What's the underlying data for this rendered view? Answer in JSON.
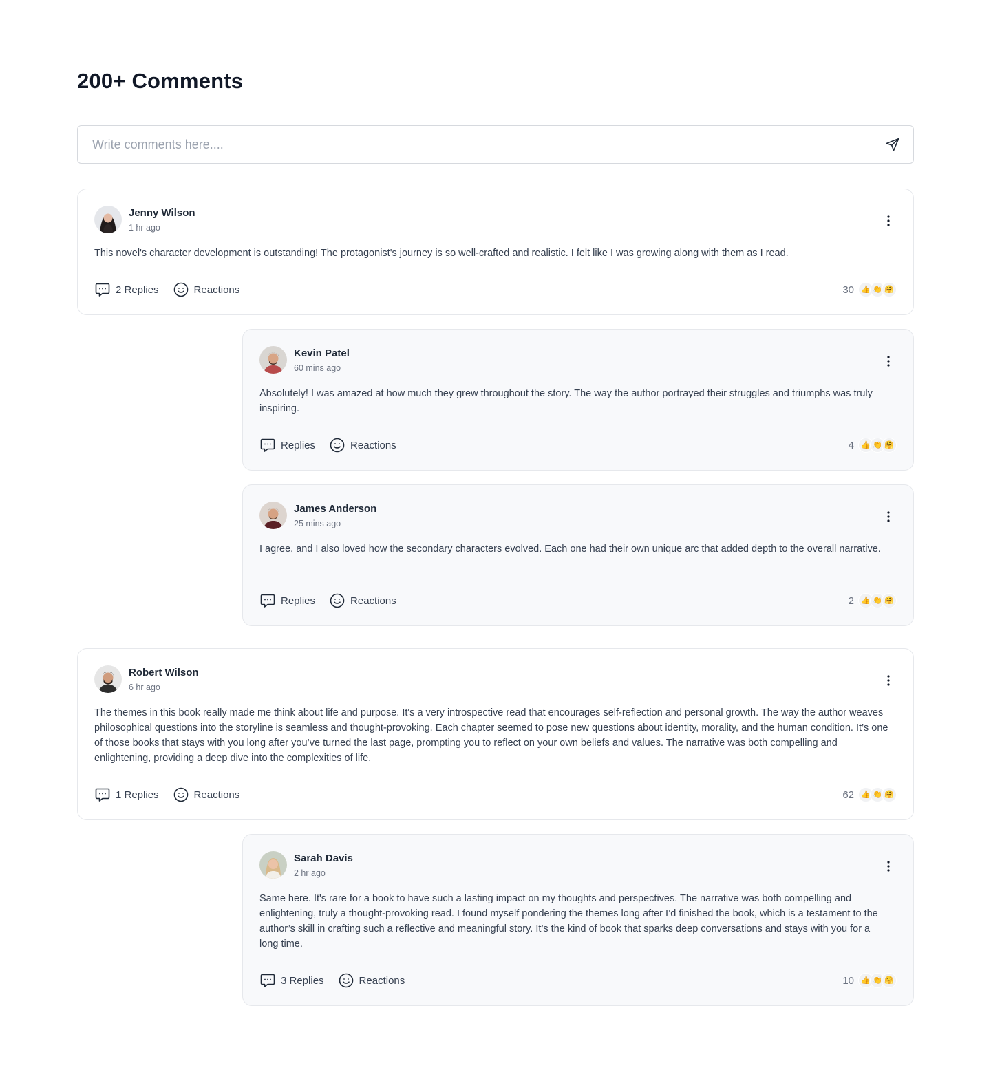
{
  "page": {
    "title": "200+ Comments"
  },
  "composer": {
    "placeholder": "Write comments here...."
  },
  "colors": {
    "card_border": "#e6e8ec",
    "reply_bg": "#f8f9fb",
    "text": "#374151"
  },
  "comments": [
    {
      "name": "Jenny Wilson",
      "time": "1 hr ago",
      "text": "This novel's character development is outstanding! The protagonist's journey is so well-crafted and realistic. I felt like I was growing along with them as I read.",
      "replies_label": "2 Replies",
      "reactions_label": "Reactions",
      "reaction_count": "30",
      "emojis": [
        "👍",
        "👏",
        "🤗"
      ]
    },
    {
      "name": "Kevin Patel",
      "time": "60 mins ago",
      "text": "Absolutely! I was amazed at how much they grew throughout the story. The way the author portrayed their struggles and triumphs was truly inspiring.",
      "replies_label": "Replies",
      "reactions_label": "Reactions",
      "reaction_count": "4",
      "emojis": [
        "👍",
        "👏",
        "🤗"
      ]
    },
    {
      "name": "James Anderson",
      "time": "25 mins ago",
      "text": "I agree, and I also loved how the secondary characters evolved. Each one had their own unique arc that added depth to the overall narrative.",
      "replies_label": "Replies",
      "reactions_label": "Reactions",
      "reaction_count": "2",
      "emojis": [
        "👍",
        "👏",
        "🤗"
      ]
    },
    {
      "name": "Robert Wilson",
      "time": "6 hr ago",
      "text": "The themes in this book really made me think about life and purpose. It's a very introspective read that encourages self-reflection and personal growth. The way the author weaves philosophical questions into the storyline is seamless and thought-provoking. Each chapter seemed to pose new questions about identity, morality, and the human condition. It’s one of those books that stays with you long after you’ve turned the last page, prompting you to reflect on your own beliefs and values. The narrative was both compelling and enlightening, providing a deep dive into the complexities of life.",
      "replies_label": "1 Replies",
      "reactions_label": "Reactions",
      "reaction_count": "62",
      "emojis": [
        "👍",
        "👏",
        "🤗"
      ]
    },
    {
      "name": "Sarah Davis",
      "time": "2 hr ago",
      "text": "Same here. It's rare for a book to have such a lasting impact on my thoughts and perspectives. The narrative was both compelling and enlightening, truly a thought-provoking read. I found myself pondering the themes long after I’d finished the book, which is a testament to the author’s skill in crafting such a reflective and meaningful story. It’s the kind of book that sparks deep conversations and stays with you for a long time.",
      "replies_label": "3 Replies",
      "reactions_label": "Reactions",
      "reaction_count": "10",
      "emojis": [
        "👍",
        "👏",
        "🤗"
      ]
    }
  ]
}
